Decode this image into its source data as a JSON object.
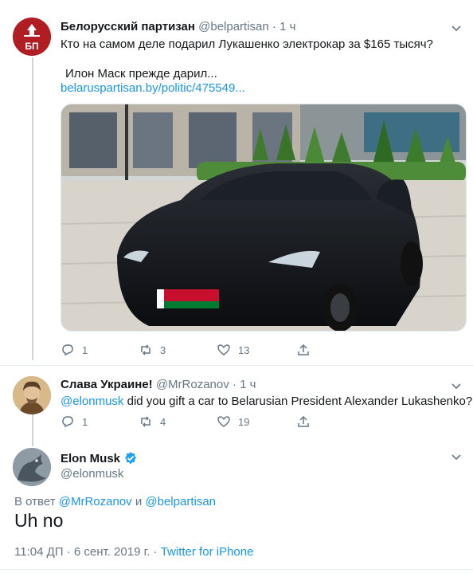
{
  "tweet1": {
    "avatar_text": "БП",
    "name": "Белорусский партизан",
    "handle": "@belpartisan",
    "dot": "·",
    "time": "1 ч",
    "text_line1": "Кто на самом деле подарил Лукашенко электрокар за $165 тысяч?",
    "text_line2": "Илон Маск прежде дарил...",
    "link": "belaruspartisan.by/politic/475549...",
    "actions": {
      "replies": "1",
      "retweets": "3",
      "likes": "13"
    }
  },
  "tweet2": {
    "name": "Слава Украине!",
    "handle": "@MrRozanov",
    "dot": "·",
    "time": "1 ч",
    "mention": "@elonmusk",
    "text": " did you gift a car to Belarusian President Alexander Lukashenko?",
    "actions": {
      "replies": "1",
      "retweets": "4",
      "likes": "19"
    }
  },
  "tweet3": {
    "name": "Elon Musk",
    "handle": "@elonmusk",
    "reply_prefix": "В ответ ",
    "reply_user1": "@MrRozanov",
    "reply_and": " и ",
    "reply_user2": "@belpartisan",
    "text": "Uh no",
    "timestamp": "11:04 ДП · 6 сент. 2019 г. · ",
    "source": "Twitter for iPhone"
  },
  "colors": {
    "link": "#1b95e0",
    "muted": "#657786",
    "verified": "#1da1f2",
    "avatar_bp": "#b01e23"
  },
  "icons": [
    "reply-icon",
    "retweet-icon",
    "like-icon",
    "share-icon",
    "chevron-down-icon",
    "verified-badge-icon"
  ]
}
